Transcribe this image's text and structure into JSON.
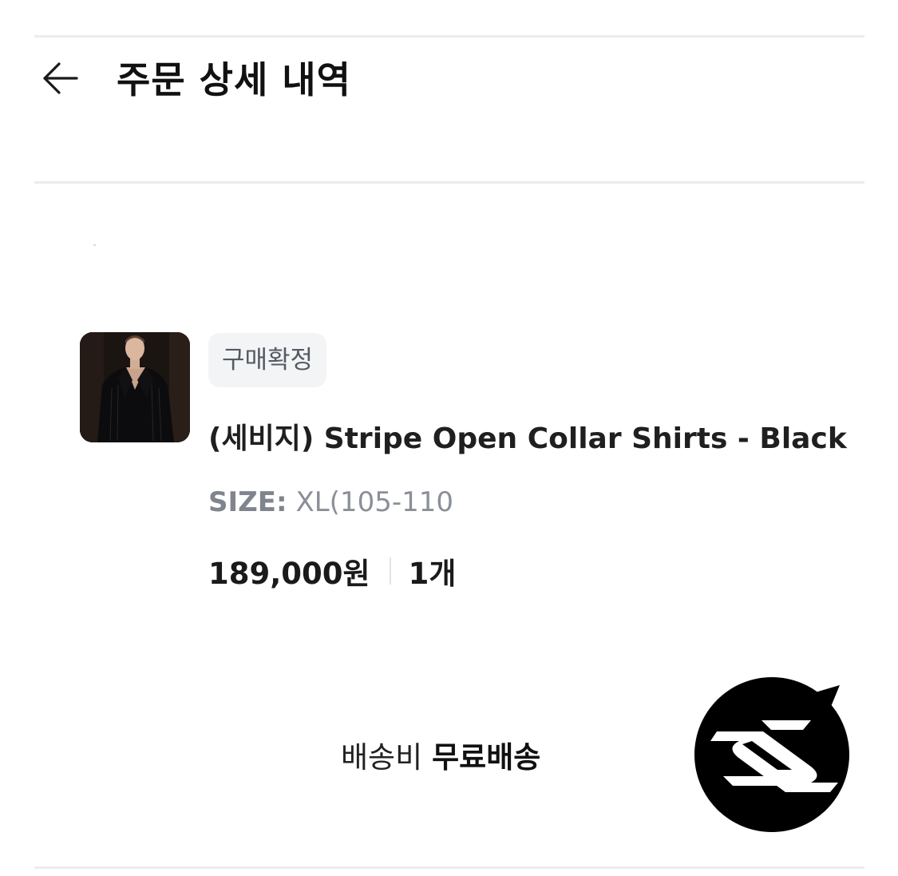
{
  "header": {
    "title": "주문 상세 내역",
    "back_icon": "arrow-left-icon"
  },
  "order_item": {
    "status": "구매확정",
    "product_name": "(세비지) Stripe Open Collar Shirts - Black",
    "option_label": "SIZE:",
    "option_value": "XL(105-110",
    "price": "189,000원",
    "quantity": "1개",
    "thumbnail": "product-photo-black-striped-shirt"
  },
  "shipping": {
    "label": "배송비",
    "value": "무료배송"
  },
  "logo": {
    "name": "brand-logo-ss-speech-bubble"
  },
  "colors": {
    "text_primary": "#1a1a1a",
    "text_secondary": "#8a8f98",
    "badge_bg": "#f3f4f6",
    "divider": "#ececee"
  }
}
